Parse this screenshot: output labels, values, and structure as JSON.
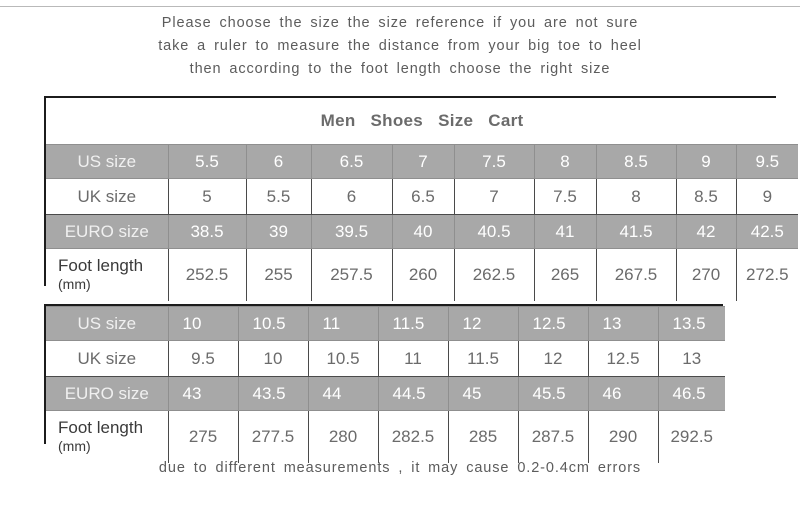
{
  "intro": {
    "line1": "Please choose the size the size reference if  you  are  not  sure",
    "line2": "take  a  ruler  to  measure  the  distance  from  your  big  toe  to  heel",
    "line3": "then   according   to   the  foot  length   choose   the  right  size"
  },
  "footnote": "due  to  different  measurements , it  may  cause  0.2-0.4cm  errors",
  "colors": {
    "shaded_row_background": "#a8a8a8",
    "shaded_row_text": "#ffffff",
    "table_border": "#1c1c1c",
    "cell_text": "#6b6b6b",
    "body_text": "#5c5c5c"
  },
  "chart_one": {
    "title": "Men Shoes Size Cart",
    "row_labels": {
      "us": "US size",
      "uk": "UK size",
      "euro": "EURO size",
      "foot_line1": "Foot length",
      "foot_line2": "(mm)"
    },
    "us_size": [
      "5.5",
      "6",
      "6.5",
      "7",
      "7.5",
      "8",
      "8.5",
      "9",
      "9.5"
    ],
    "uk_size": [
      "5",
      "5.5",
      "6",
      "6.5",
      "7",
      "7.5",
      "8",
      "8.5",
      "9"
    ],
    "euro_size": [
      "38.5",
      "39",
      "39.5",
      "40",
      "40.5",
      "41",
      "41.5",
      "42",
      "42.5"
    ],
    "foot_length": [
      "252.5",
      "255",
      "257.5",
      "260",
      "262.5",
      "265",
      "267.5",
      "270",
      "272.5"
    ]
  },
  "chart_two": {
    "row_labels": {
      "us": "US size",
      "uk": "UK size",
      "euro": "EURO size",
      "foot_line1": "Foot length",
      "foot_line2": "(mm)"
    },
    "us_size": [
      "10",
      "10.5",
      "11",
      "11.5",
      "12",
      "12.5",
      "13",
      "13.5"
    ],
    "uk_size": [
      "9.5",
      "10",
      "10.5",
      "11",
      "11.5",
      "12",
      "12.5",
      "13"
    ],
    "euro_size": [
      "43",
      "43.5",
      "44",
      "44.5",
      "45",
      "45.5",
      "46",
      "46.5"
    ],
    "foot_length": [
      "275",
      "277.5",
      "280",
      "282.5",
      "285",
      "287.5",
      "290",
      "292.5"
    ]
  }
}
